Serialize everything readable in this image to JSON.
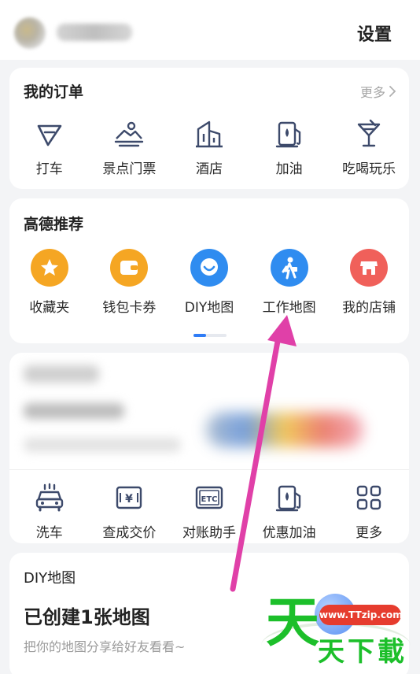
{
  "header": {
    "settings_label": "设置"
  },
  "orders": {
    "title": "我的订单",
    "more_label": "更多",
    "items": [
      {
        "label": "打车",
        "icon": "taxi-icon"
      },
      {
        "label": "景点门票",
        "icon": "scenic-ticket-icon"
      },
      {
        "label": "酒店",
        "icon": "hotel-icon"
      },
      {
        "label": "加油",
        "icon": "fuel-icon"
      },
      {
        "label": "吃喝玩乐",
        "icon": "cocktail-icon"
      }
    ]
  },
  "recommend": {
    "title": "高德推荐",
    "items": [
      {
        "label": "收藏夹",
        "icon": "star-icon",
        "color": "#f5a623"
      },
      {
        "label": "钱包卡券",
        "icon": "wallet-icon",
        "color": "#f5a623"
      },
      {
        "label": "DIY地图",
        "icon": "diy-map-icon",
        "color": "#2f8cf0"
      },
      {
        "label": "工作地图",
        "icon": "work-map-icon",
        "color": "#2f8cf0"
      },
      {
        "label": "我的店铺",
        "icon": "shop-icon",
        "color": "#f0605a"
      }
    ],
    "page_index": 1,
    "page_count": 2
  },
  "services": {
    "items": [
      {
        "label": "洗车",
        "icon": "car-wash-icon"
      },
      {
        "label": "查成交价",
        "icon": "price-check-icon",
        "icon_text": "¥"
      },
      {
        "label": "对账助手",
        "icon": "etc-icon",
        "icon_text": "ETC"
      },
      {
        "label": "优惠加油",
        "icon": "discount-fuel-icon"
      },
      {
        "label": "更多",
        "icon": "grid-more-icon"
      }
    ]
  },
  "diy_map": {
    "title": "DIY地图",
    "headline": "已创建1张地图",
    "subtitle": "把你的地图分享给好友看看~"
  },
  "watermark": {
    "url": "www.TTzip.com",
    "char1": "天",
    "text": "天下載"
  },
  "colors": {
    "accent_blue": "#2f7cf6",
    "icon_orange": "#f5a623",
    "icon_red": "#f0605a",
    "arrow_magenta": "#e040a8",
    "watermark_green": "#1cbf2a",
    "watermark_red": "#e63c2e"
  }
}
